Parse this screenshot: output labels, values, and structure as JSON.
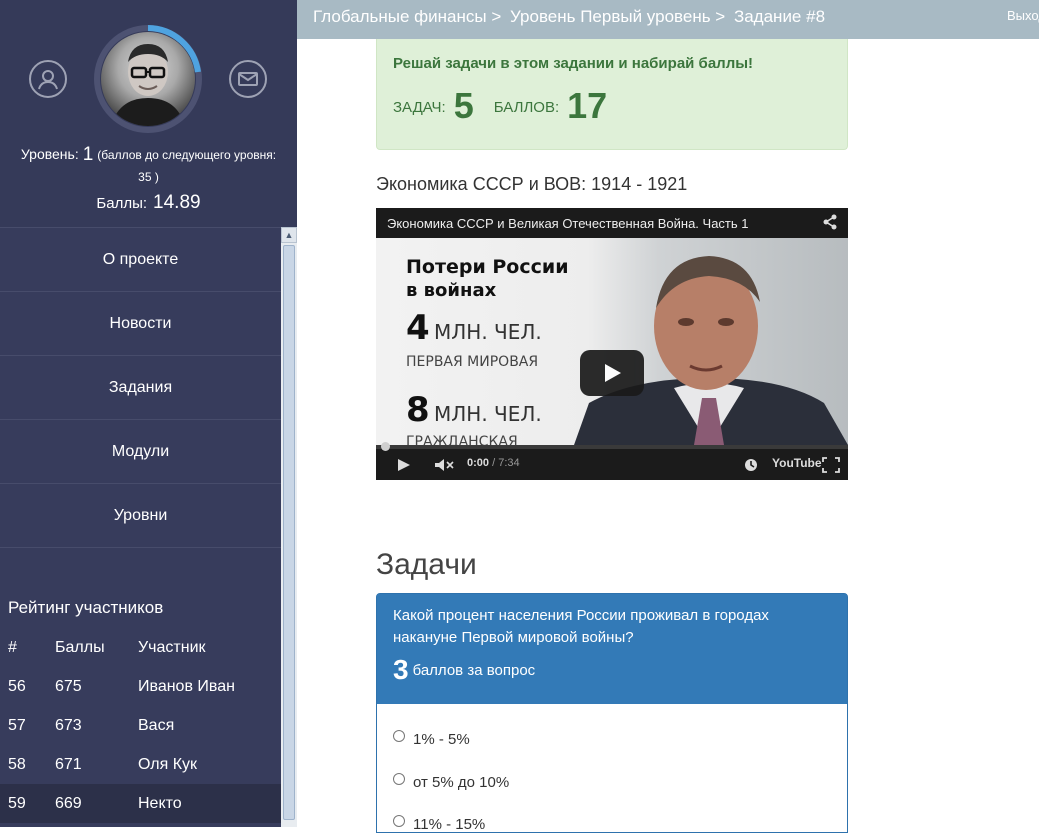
{
  "sidebar": {
    "level_label": "Уровень:",
    "level_value": "1",
    "level_hint": "(баллов до следующего уровня:",
    "level_hint_tail": "35 )",
    "score_label": "Баллы:",
    "score_value": "14.89",
    "level_progress_percent": 30,
    "menu": [
      {
        "label": "О проекте"
      },
      {
        "label": "Новости"
      },
      {
        "label": "Задания"
      },
      {
        "label": "Модули"
      },
      {
        "label": "Уровни"
      }
    ],
    "rating": {
      "title": "Рейтинг участников",
      "headers": [
        "#",
        "Баллы",
        "Участник"
      ],
      "rows": [
        [
          "56",
          "675",
          "Иванов Иван"
        ],
        [
          "57",
          "673",
          "Вася"
        ],
        [
          "58",
          "671",
          "Оля Кук"
        ],
        [
          "59",
          "669",
          "Некто"
        ]
      ]
    }
  },
  "topbar": {
    "crumbs": [
      "Глобальные финансы >",
      "Уровень Первый уровень >",
      "Задание #8"
    ],
    "exit_label": "Выход"
  },
  "alert": {
    "title": "Решай задачи в этом задании и набирай баллы!",
    "tasks_label": "ЗАДАЧ:",
    "tasks_value": "5",
    "points_label": "БАЛЛОВ:",
    "points_value": "17"
  },
  "video": {
    "section_title": "Экономика СССР и ВОВ: 1914 - 1921",
    "player_title": "Экономика СССР и Великая Отечественная Война. Часть 1",
    "frame_line1": "Потери России",
    "frame_line2": "в войнах",
    "frame_num1": "4",
    "frame_num1_text": "МЛН. ЧЕЛ.",
    "frame_sub1": "ПЕРВАЯ МИРОВАЯ",
    "frame_num2": "8",
    "frame_num2_text": "МЛН. ЧЕЛ.",
    "frame_sub2": "ГРАЖДАНСКАЯ",
    "time_current": "0:00",
    "time_total": "/ 7:34",
    "youtube_label": "YouTube"
  },
  "tasks": {
    "title": "Задачи",
    "question": "Какой процент населения России проживал в городах накануне Первой мировой войны?",
    "points_value": "3",
    "points_label": "баллов за вопрос",
    "options": [
      "1% - 5%",
      "от 5% до 10%",
      "11% - 15%"
    ]
  },
  "colors": {
    "sidebar_bg": "#373c5c",
    "topbar_bg": "#a8bac4",
    "alert_bg": "#dff0d8",
    "alert_text": "#3c763d",
    "panel_primary": "#337ab7",
    "ring_accent": "#4fa3e0"
  }
}
